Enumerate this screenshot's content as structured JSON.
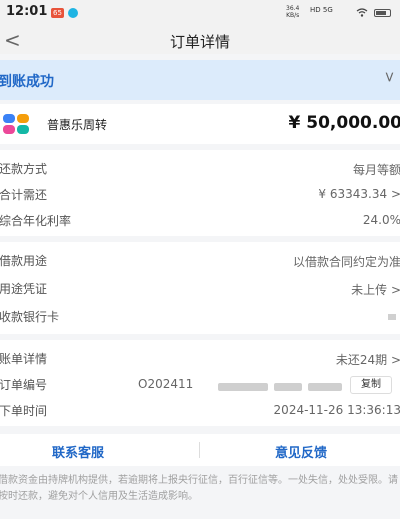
{
  "status_bar": {
    "time": "12:01",
    "badge": "65",
    "net_speed_value": "36.4",
    "net_speed_unit": "KB/s",
    "signal": "HD 5G"
  },
  "nav": {
    "back_glyph": "<",
    "title": "订单详情"
  },
  "status_banner": {
    "text": "到账成功",
    "chevron_glyph": ">"
  },
  "product": {
    "name": "普惠乐周转",
    "amount": "¥ 50,000.00",
    "logo_colors": [
      "#3b82f6",
      "#f59e0b",
      "#ec4899",
      "#14b8a6"
    ]
  },
  "repayment": [
    {
      "label": "还款方式",
      "value": "每月等额"
    },
    {
      "label": "合计需还",
      "value": "¥ 63343.34 >"
    },
    {
      "label": "综合年化利率",
      "value": "24.0%"
    }
  ],
  "loan_info": [
    {
      "label": "借款用途",
      "value": "以借款合同约定为准"
    },
    {
      "label": "用途凭证",
      "value": "未上传 >"
    },
    {
      "label": "收款银行卡",
      "value": ""
    }
  ],
  "order_info": {
    "bill_label": "账单详情",
    "bill_value": "未还24期 >",
    "order_no_label": "订单编号",
    "order_no_value": "O202411",
    "copy_label": "复制",
    "order_time_label": "下单时间",
    "order_time_value": "2024-11-26 13:36:13"
  },
  "footer": {
    "contact_label": "联系客服",
    "feedback_label": "意见反馈"
  },
  "disclaimer": "借款资金由持牌机构提供，若逾期将上报央行征信，百行征信等。一处失信，处处受限。请按时还款，避免对个人信用及生活造成影响。"
}
